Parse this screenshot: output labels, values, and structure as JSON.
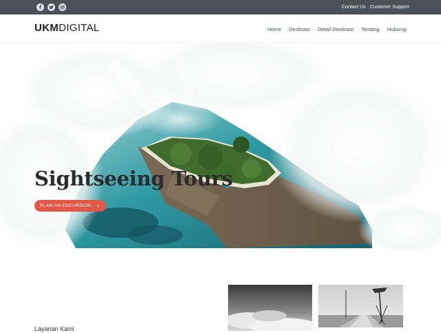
{
  "topbar": {
    "social": [
      {
        "icon": "facebook-icon"
      },
      {
        "icon": "twitter-icon"
      },
      {
        "icon": "instagram-icon"
      }
    ],
    "links": [
      "Contact Us",
      "Customer Support"
    ]
  },
  "header": {
    "logo_bold": "UKM",
    "logo_light": "DIGITAL",
    "nav": [
      "Home",
      "Destinasi",
      "Detail Destinasi",
      "Tentang",
      "Hubungi"
    ]
  },
  "hero": {
    "title": "Sightseeing Tours",
    "cta_label": "PLAN AN EXCURSION",
    "cta_icon": "chevron-right-icon"
  },
  "section": {
    "heading": "Layanan Kami"
  },
  "colors": {
    "topbar_bg": "#4b5059",
    "accent": "#e15846",
    "text_dark": "#2b2b2b"
  }
}
